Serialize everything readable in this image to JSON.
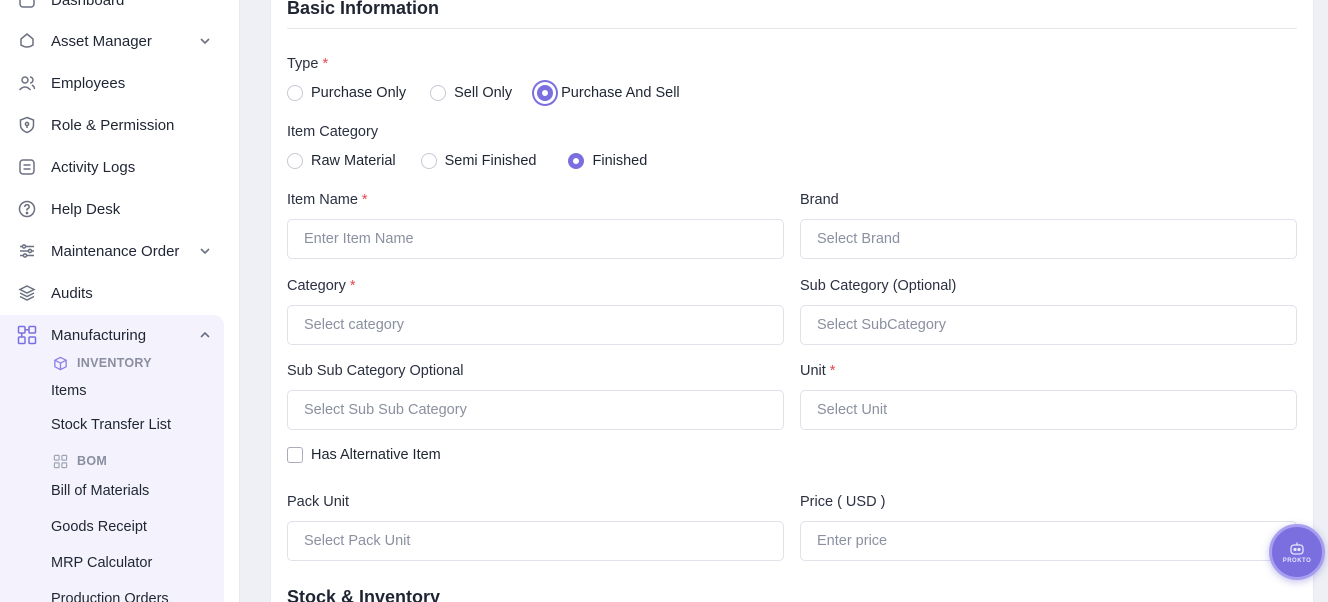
{
  "sidebar": {
    "items": [
      {
        "label": "Dashboard"
      },
      {
        "label": "Asset Manager"
      },
      {
        "label": "Employees"
      },
      {
        "label": "Role & Permission"
      },
      {
        "label": "Activity Logs"
      },
      {
        "label": "Help Desk"
      },
      {
        "label": "Maintenance Order"
      },
      {
        "label": "Audits"
      },
      {
        "label": "Manufacturing"
      }
    ],
    "groups": {
      "inventory": "INVENTORY",
      "bom": "BOM"
    },
    "sub_items": {
      "items": "Items",
      "stock_transfer": "Stock Transfer List",
      "bill_of_materials": "Bill of Materials",
      "goods_receipt": "Goods Receipt",
      "mrp_calculator": "MRP Calculator",
      "production_orders": "Production Orders"
    }
  },
  "form": {
    "section_basic": "Basic Information",
    "section_stock": "Stock & Inventory",
    "type": {
      "label": "Type",
      "required": "*",
      "options": [
        "Purchase Only",
        "Sell Only",
        "Purchase And Sell"
      ],
      "selected": "Purchase And Sell"
    },
    "item_category": {
      "label": "Item Category",
      "options": [
        "Raw Material",
        "Semi Finished",
        "Finished"
      ],
      "selected": "Finished"
    },
    "item_name": {
      "label": "Item Name",
      "required": "*",
      "placeholder": "Enter Item Name"
    },
    "brand": {
      "label": "Brand",
      "placeholder": "Select Brand"
    },
    "category": {
      "label": "Category",
      "required": "*",
      "placeholder": "Select category"
    },
    "sub_category": {
      "label": "Sub Category (Optional)",
      "placeholder": "Select SubCategory"
    },
    "sub_sub_category": {
      "label": "Sub Sub Category Optional",
      "placeholder": "Select Sub Sub Category"
    },
    "unit": {
      "label": "Unit",
      "required": "*",
      "placeholder": "Select Unit"
    },
    "has_alternative": {
      "label": "Has Alternative Item",
      "checked": false
    },
    "pack_unit": {
      "label": "Pack Unit",
      "placeholder": "Select Pack Unit"
    },
    "price": {
      "label": "Price ( USD )",
      "placeholder": "Enter price"
    }
  },
  "fab": {
    "label": "PROKTO"
  },
  "colors": {
    "accent": "#7b6fe0",
    "required": "#e5484d",
    "sidebar_active_bg": "#f4f3fd"
  }
}
